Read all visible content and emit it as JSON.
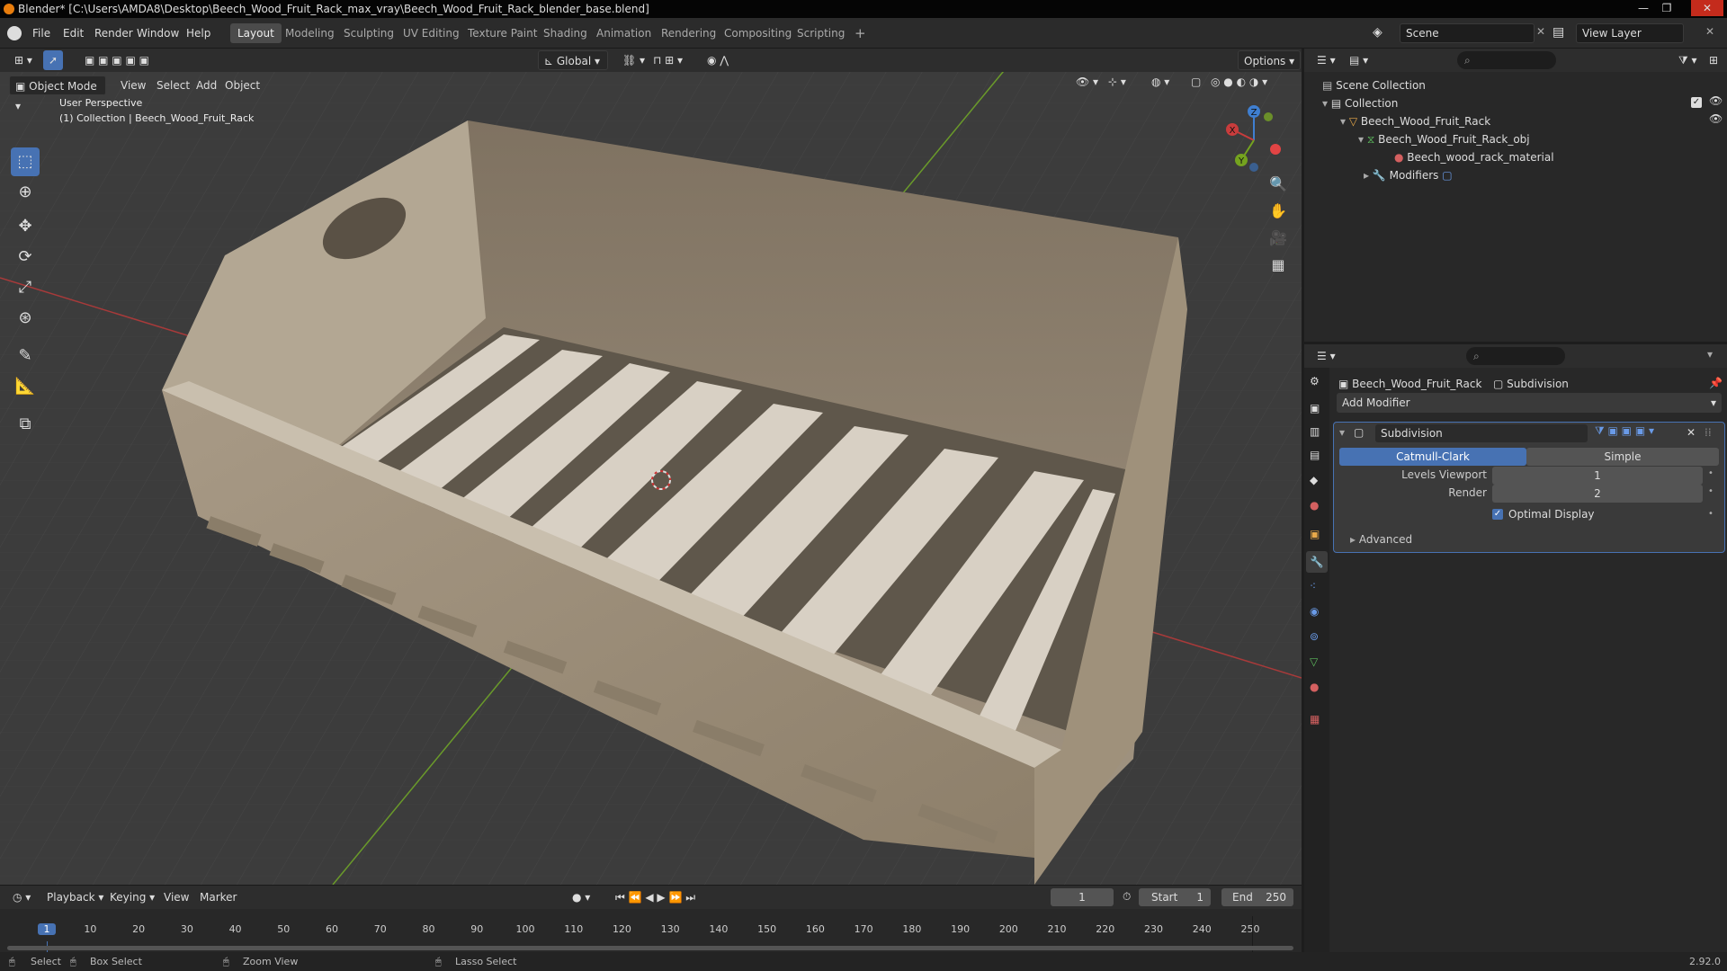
{
  "window": {
    "title": "Blender* [C:\\Users\\AMDA8\\Desktop\\Beech_Wood_Fruit_Rack_max_vray\\Beech_Wood_Fruit_Rack_blender_base.blend]",
    "minimize": "—",
    "maximize": "❐",
    "close": "✕"
  },
  "menu": [
    "File",
    "Edit",
    "Render",
    "Window",
    "Help"
  ],
  "workspaces": [
    "Layout",
    "Modeling",
    "Sculpting",
    "UV Editing",
    "Texture Paint",
    "Shading",
    "Animation",
    "Rendering",
    "Compositing",
    "Scripting"
  ],
  "add_workspace": "+",
  "scene": {
    "scene_name": "Scene",
    "view_layer": "View Layer"
  },
  "viewport": {
    "mode": "Object Mode",
    "menus": [
      "View",
      "Select",
      "Add",
      "Object"
    ],
    "transform_orientation": "Global",
    "options": "Options",
    "overlay_text_1": "User Perspective",
    "overlay_text_2": "(1) Collection | Beech_Wood_Fruit_Rack",
    "gizmo": {
      "x": "X",
      "y": "Y",
      "z": "Z"
    }
  },
  "outliner": {
    "rows": [
      {
        "label": "Scene Collection",
        "indent": 0
      },
      {
        "label": "Collection",
        "indent": 1
      },
      {
        "label": "Beech_Wood_Fruit_Rack",
        "indent": 2
      },
      {
        "label": "Beech_Wood_Fruit_Rack_obj",
        "indent": 3
      },
      {
        "label": "Beech_wood_rack_material",
        "indent": 4
      },
      {
        "label": "Modifiers",
        "indent": 3
      }
    ]
  },
  "properties": {
    "object_name": "Beech_Wood_Fruit_Rack",
    "modifier_tab_name": "Subdivision",
    "add_modifier": "Add Modifier",
    "modifier": {
      "name": "Subdivision",
      "algo_active": "Catmull-Clark",
      "algo_other": "Simple",
      "levels_viewport_label": "Levels Viewport",
      "levels_viewport": "1",
      "render_label": "Render",
      "render": "2",
      "optimal_display": "Optimal Display",
      "optimal_display_checked": true,
      "advanced": "Advanced"
    }
  },
  "timeline": {
    "menus": [
      "Playback",
      "Keying",
      "View",
      "Marker"
    ],
    "current_frame": "1",
    "start_label": "Start",
    "start": "1",
    "end_label": "End",
    "end": "250",
    "ticks": [
      "1",
      "10",
      "20",
      "30",
      "40",
      "50",
      "60",
      "70",
      "80",
      "90",
      "100",
      "110",
      "120",
      "130",
      "140",
      "150",
      "160",
      "170",
      "180",
      "190",
      "200",
      "210",
      "220",
      "230",
      "240",
      "250"
    ]
  },
  "status": {
    "select": "Select",
    "box_select": "Box Select",
    "zoom_view": "Zoom View",
    "lasso_select": "Lasso Select",
    "version": "2.92.0"
  },
  "colors": {
    "accent": "#4772b3",
    "orange": "#e87d0d",
    "x_axis": "#c83c3c",
    "y_axis": "#74a31f",
    "z_axis": "#3f7fd1"
  }
}
